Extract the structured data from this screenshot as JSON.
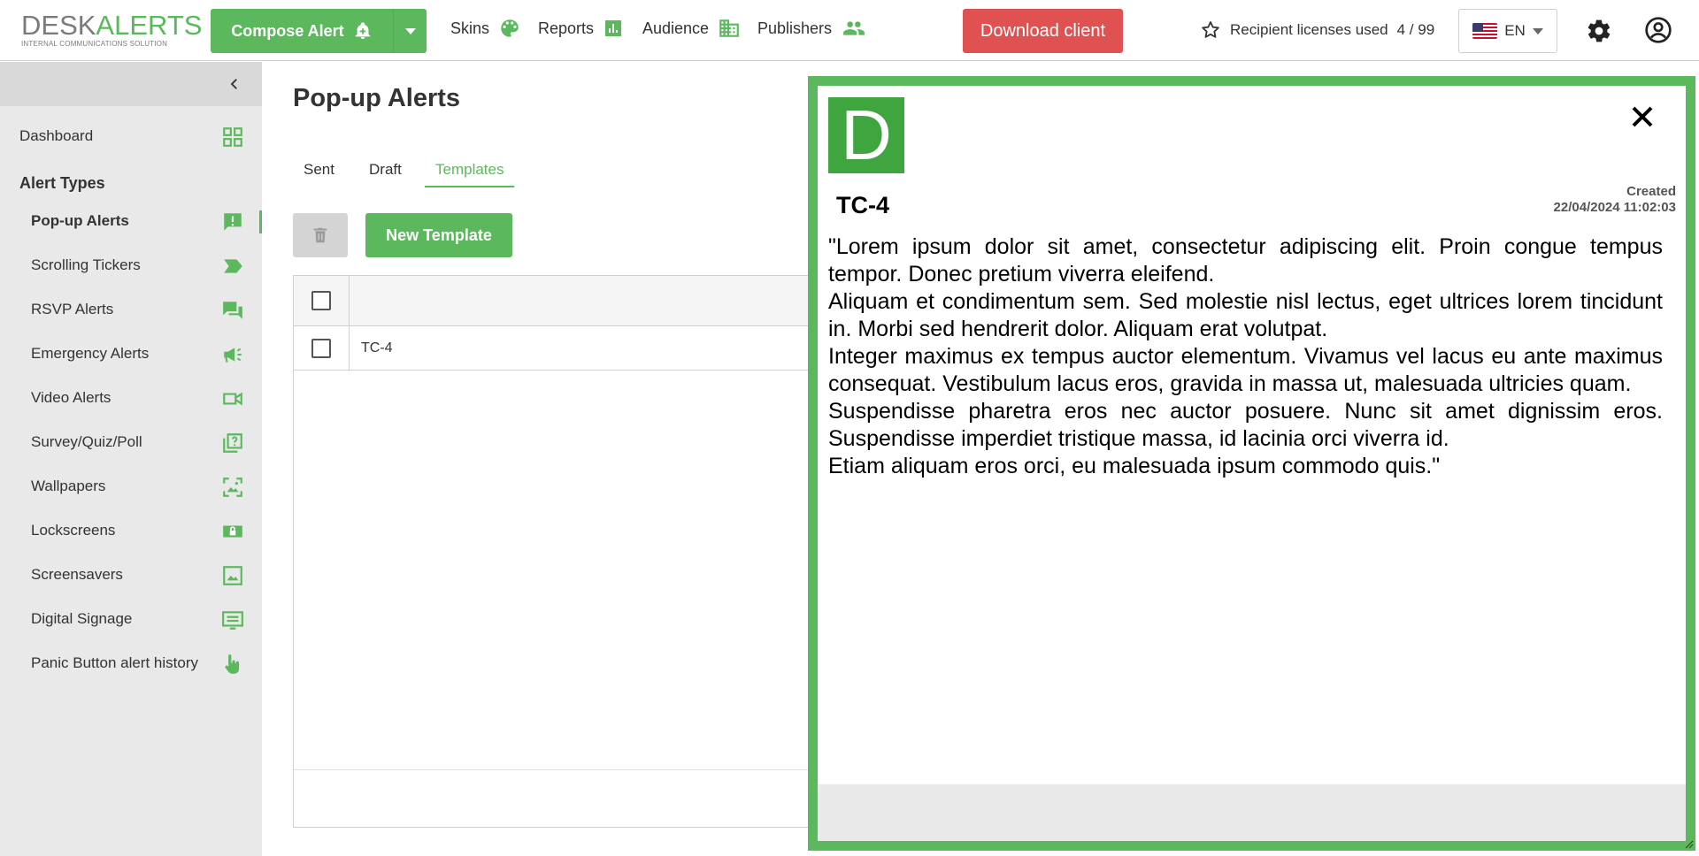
{
  "brand": {
    "desk": "DESK",
    "alerts": "ALERTS",
    "tagline": "INTERNAL COMMUNICATIONS SOLUTION"
  },
  "topbar": {
    "compose_label": "Compose Alert",
    "nav": [
      {
        "label": "Skins",
        "icon": "palette-icon"
      },
      {
        "label": "Reports",
        "icon": "bar-chart-icon"
      },
      {
        "label": "Audience",
        "icon": "building-icon"
      },
      {
        "label": "Publishers",
        "icon": "people-icon"
      }
    ],
    "download_label": "Download client",
    "licenses_label": "Recipient licenses used",
    "licenses_value": "4 / 99",
    "language": "EN"
  },
  "sidebar": {
    "dashboard": "Dashboard",
    "section_title": "Alert Types",
    "items": [
      {
        "label": "Pop-up Alerts",
        "icon": "exclamation-bubble-icon"
      },
      {
        "label": "Scrolling Tickers",
        "icon": "ticker-icon"
      },
      {
        "label": "RSVP Alerts",
        "icon": "chat-bubbles-icon"
      },
      {
        "label": "Emergency Alerts",
        "icon": "megaphone-icon"
      },
      {
        "label": "Video Alerts",
        "icon": "video-camera-icon"
      },
      {
        "label": "Survey/Quiz/Poll",
        "icon": "question-icon"
      },
      {
        "label": "Wallpapers",
        "icon": "wallpaper-icon"
      },
      {
        "label": "Lockscreens",
        "icon": "lock-icon"
      },
      {
        "label": "Screensavers",
        "icon": "image-icon"
      },
      {
        "label": "Digital Signage",
        "icon": "signage-icon"
      },
      {
        "label": "Panic Button alert history",
        "icon": "hand-pointer-icon"
      }
    ]
  },
  "main": {
    "title": "Pop-up Alerts",
    "tabs": [
      "Sent",
      "Draft",
      "Templates"
    ],
    "active_tab": "Templates",
    "new_template_label": "New Template",
    "rows": [
      {
        "name": "TC-4"
      }
    ]
  },
  "preview": {
    "badge_letter": "D",
    "title": "TC-4",
    "created_label": "Created",
    "created_value": "22/04/2024 11:02:03",
    "paragraphs": [
      "\"Lorem ipsum dolor sit amet, consectetur adipiscing elit. Proin congue tempus tempor. Donec pretium viverra eleifend.",
      "Aliquam et condimentum sem. Sed molestie nisl lectus, eget ultrices lorem tincidunt in. Morbi sed hendrerit dolor. Aliquam erat volutpat.",
      "Integer maximus ex tempus auctor elementum. Vivamus vel lacus eu ante maximus consequat. Vestibulum lacus eros, gravida in massa ut, malesuada ultricies quam.",
      "Suspendisse pharetra eros nec auctor posuere. Nunc sit amet dignissim eros. Suspendisse imperdiet tristique massa, id lacinia orci viverra id.",
      "Etiam aliquam eros orci, eu malesuada ipsum commodo quis.\""
    ]
  },
  "colors": {
    "accent": "#5cb85c",
    "danger": "#e05252",
    "sidebar_bg": "#e9e9e9"
  }
}
